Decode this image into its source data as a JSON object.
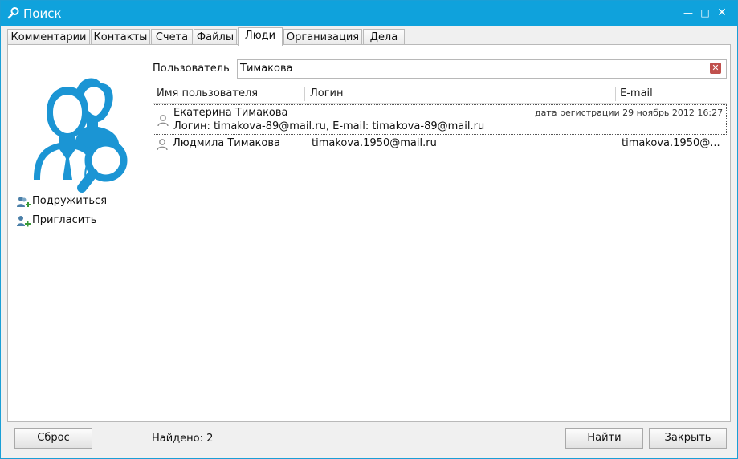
{
  "window": {
    "title": "Поиск",
    "icon": "search-icon",
    "accent_color": "#0fa2dc"
  },
  "tabs": [
    {
      "label": "Комментарии"
    },
    {
      "label": "Контакты"
    },
    {
      "label": "Счета"
    },
    {
      "label": "Файлы"
    },
    {
      "label": "Люди",
      "active": true
    },
    {
      "label": "Организация"
    },
    {
      "label": "Дела"
    }
  ],
  "sidebar": {
    "actions": [
      {
        "label": "Подружиться",
        "icon": "add-friend-icon"
      },
      {
        "label": "Пригласить",
        "icon": "invite-user-icon"
      }
    ]
  },
  "search": {
    "label": "Пользователь",
    "value": "Тимакова"
  },
  "table": {
    "columns": [
      "Имя пользователя",
      "Логин",
      "E-mail"
    ],
    "rows": [
      {
        "name": "Екатерина Тимакова",
        "registration": "дата регистрации 29 ноябрь 2012 16:27",
        "details": "Логин: timakova-89@mail.ru, E-mail: timakova-89@mail.ru",
        "expanded": true
      },
      {
        "name": "Людмила Тимакова",
        "login": "timakova.1950@mail.ru",
        "email": "timakova.1950@..."
      }
    ]
  },
  "footer": {
    "reset_label": "Сброс",
    "found_text": "Найдено: 2",
    "find_label": "Найти",
    "close_label": "Закрыть"
  }
}
